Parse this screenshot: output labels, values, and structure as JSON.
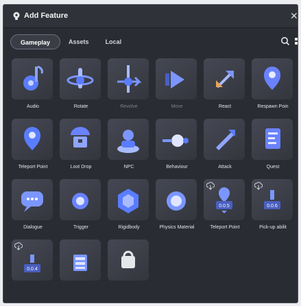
{
  "window": {
    "title": "Add Feature"
  },
  "tabs": [
    {
      "label": "Gameplay",
      "active": true
    },
    {
      "label": "Assets",
      "active": false
    },
    {
      "label": "Local",
      "active": false
    }
  ],
  "colors": {
    "accent": "#6a82ff",
    "panel": "#2a2c33",
    "thumb": "#3c3f48"
  },
  "features": [
    {
      "label": "Audio",
      "icon": "audio-icon"
    },
    {
      "label": "Rotate",
      "icon": "rotate-icon"
    },
    {
      "label": "Revolve",
      "icon": "revolve-icon",
      "dim": true
    },
    {
      "label": "Move",
      "icon": "move-icon",
      "dim": true
    },
    {
      "label": "React",
      "icon": "react-icon"
    },
    {
      "label": "Respawn Poin",
      "icon": "respawn-point-icon"
    },
    {
      "label": "Teleport Point",
      "icon": "teleport-point-icon"
    },
    {
      "label": "Loot Drop",
      "icon": "loot-drop-icon"
    },
    {
      "label": "NPC",
      "icon": "npc-icon"
    },
    {
      "label": "Behaviour",
      "icon": "behaviour-icon"
    },
    {
      "label": "Attack",
      "icon": "attack-icon"
    },
    {
      "label": "Quest",
      "icon": "quest-icon"
    },
    {
      "label": "Dialogue",
      "icon": "dialogue-icon"
    },
    {
      "label": "Trigger",
      "icon": "trigger-icon"
    },
    {
      "label": "Rigidbody",
      "icon": "rigidbody-icon"
    },
    {
      "label": "Physics Material",
      "icon": "physics-material-icon"
    },
    {
      "label": "Teleport Point",
      "icon": "teleport-point-package-icon",
      "version": "0.0.5",
      "download": true
    },
    {
      "label": "Pick-up abilit",
      "icon": "pick-up-ability-icon",
      "version": "0.0.6",
      "download": true
    },
    {
      "label": "",
      "icon": "animation-package-icon",
      "version": "0.0.4",
      "download": true
    },
    {
      "label": "",
      "icon": "npc-animation-icon"
    },
    {
      "label": "",
      "icon": "find-more-icon"
    }
  ]
}
